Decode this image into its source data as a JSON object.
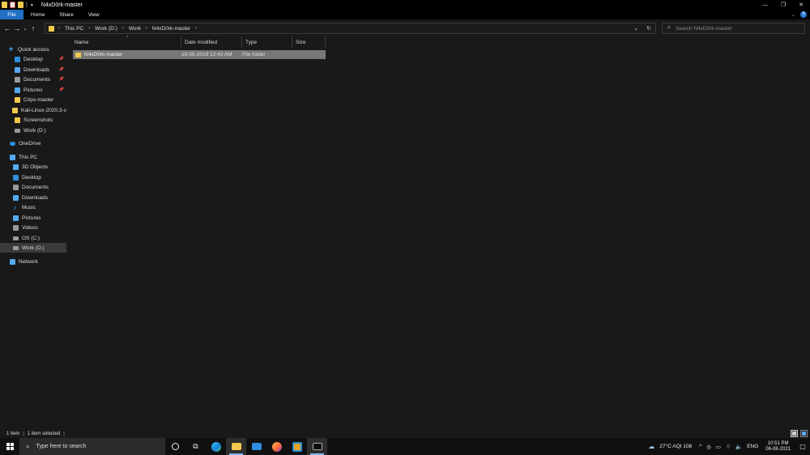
{
  "window": {
    "title": "N4xD0rk-master",
    "controls": {
      "minimize": "—",
      "maximize": "❐",
      "close": "✕"
    }
  },
  "ribbon": {
    "tabs": [
      "File",
      "Home",
      "Share",
      "View"
    ]
  },
  "address": {
    "crumbs": [
      "This PC",
      "Work (D:)",
      "Work",
      "N4xD0rk-master"
    ],
    "search_placeholder": "Search N4xD0rk-master"
  },
  "nav_pane": {
    "quick_access_label": "Quick access",
    "quick_access": [
      {
        "label": "Desktop",
        "icon": "desktop-icon",
        "pinned": true
      },
      {
        "label": "Downloads",
        "icon": "downloads-icon",
        "pinned": true
      },
      {
        "label": "Documents",
        "icon": "documents-icon",
        "pinned": true
      },
      {
        "label": "Pictures",
        "icon": "pictures-icon",
        "pinned": true
      },
      {
        "label": "Crips-master",
        "icon": "folder-icon",
        "pinned": false
      },
      {
        "label": "Kali-Linux-2020.3-v",
        "icon": "folder-icon",
        "pinned": false
      },
      {
        "label": "Screenshots",
        "icon": "folder-icon",
        "pinned": false
      },
      {
        "label": "Work (D:)",
        "icon": "drive-icon",
        "pinned": false
      }
    ],
    "onedrive_label": "OneDrive",
    "this_pc_label": "This PC",
    "this_pc": [
      {
        "label": "3D Objects",
        "icon": "3d-objects-icon"
      },
      {
        "label": "Desktop",
        "icon": "desktop-icon"
      },
      {
        "label": "Documents",
        "icon": "documents-icon"
      },
      {
        "label": "Downloads",
        "icon": "downloads-icon"
      },
      {
        "label": "Music",
        "icon": "music-icon"
      },
      {
        "label": "Pictures",
        "icon": "pictures-icon"
      },
      {
        "label": "Videos",
        "icon": "videos-icon"
      },
      {
        "label": "OS (C:)",
        "icon": "drive-icon"
      },
      {
        "label": "Work (D:)",
        "icon": "drive-icon"
      }
    ],
    "network_label": "Network"
  },
  "file_list": {
    "columns": [
      "Name",
      "Date modified",
      "Type",
      "Size"
    ],
    "rows": [
      {
        "name": "N4xD0rk-master",
        "date_modified": "10-05-2018 12:43 AM",
        "type": "File folder",
        "size": ""
      }
    ]
  },
  "status": {
    "item_count": "1 item",
    "selected": "1 item selected"
  },
  "taskbar": {
    "search_placeholder": "Type here to search",
    "weather": "27°C  AQI 108",
    "language": "ENG",
    "time": "10:51 PM",
    "date": "06-08-2021"
  },
  "colors": {
    "accent": "#1f6fc5",
    "folder": "#f3c94e",
    "background": "#191919",
    "selection": "#777777"
  }
}
